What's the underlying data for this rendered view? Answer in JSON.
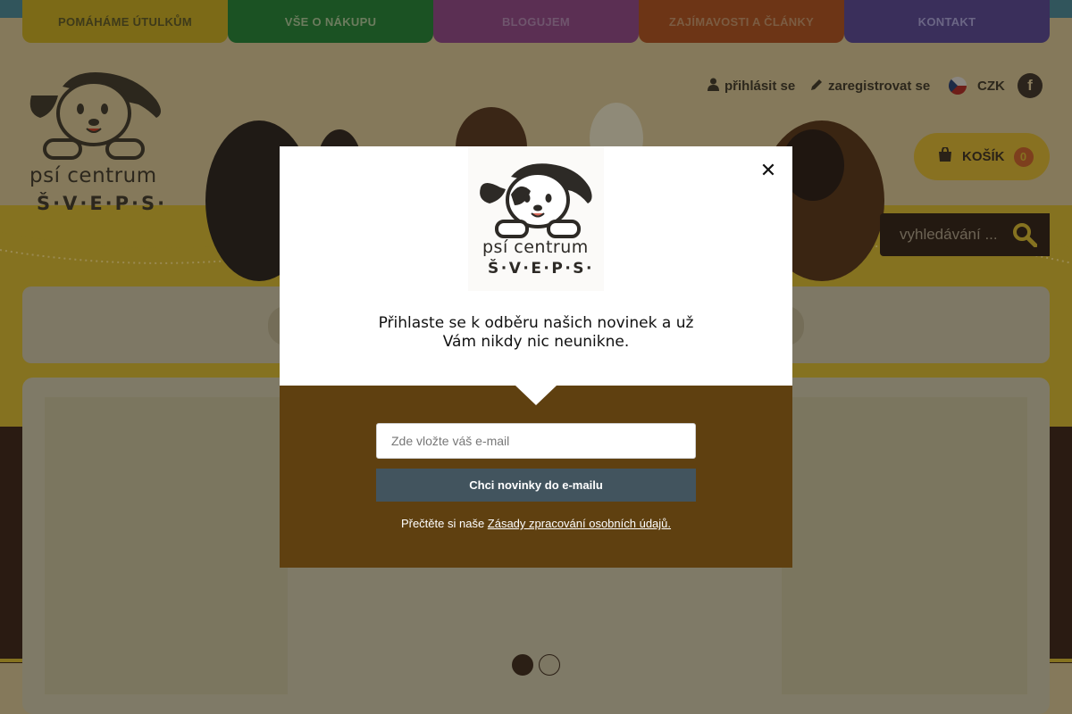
{
  "nav": {
    "items": [
      {
        "label": "POMÁHÁME ÚTULKŮM"
      },
      {
        "label": "VŠE O NÁKUPU"
      },
      {
        "label": "BLOGUJEM"
      },
      {
        "label": "ZAJÍMAVOSTI A ČLÁNKY"
      },
      {
        "label": "KONTAKT"
      }
    ]
  },
  "brand": {
    "name": "psí centrum",
    "sub": "Š·V·E·P·S·"
  },
  "header": {
    "login_label": "přihlásit se",
    "register_label": "zaregistrovat se",
    "currency": "CZK",
    "facebook_label": "f",
    "cart_label": "KOŠÍK",
    "cart_count": "0",
    "search_placeholder": "vyhledávání ..."
  },
  "modal": {
    "logo_name": "psí centrum",
    "logo_sub": "Š·V·E·P·S·",
    "message_line1": "Přihlaste se k odběru našich novinek a už",
    "message_line2": "Vám nikdy nic neunikne.",
    "email_placeholder": "Zde vložte váš e-mail",
    "submit_label": "Chci novinky do e-mailu",
    "privacy_prefix": "Přečtěte si naše ",
    "privacy_link": "Zásady zpracování osobních údajů.",
    "close_symbol": "✕"
  },
  "colors": {
    "modal_bottom": "#5f4010",
    "submit_button": "#42545e",
    "accent_yellow": "#f0c830"
  }
}
